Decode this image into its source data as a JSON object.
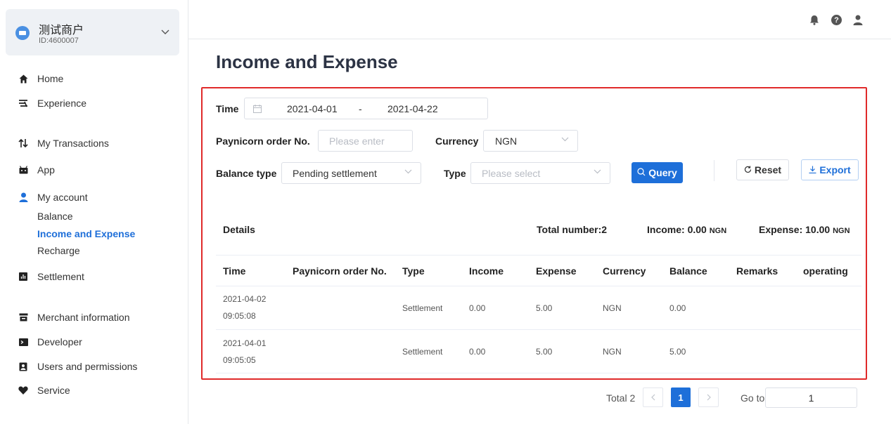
{
  "merchant": {
    "name": "测试商户",
    "id": "ID:4600007"
  },
  "sidebar": {
    "items": [
      {
        "key": "home",
        "label": "Home",
        "icon": "home-icon"
      },
      {
        "key": "experience",
        "label": "Experience",
        "icon": "experience-icon"
      },
      {
        "key": "transactions",
        "label": "My Transactions",
        "icon": "transactions-icon"
      },
      {
        "key": "app",
        "label": "App",
        "icon": "app-icon"
      },
      {
        "key": "account",
        "label": "My account",
        "icon": "user-icon"
      },
      {
        "key": "settlement",
        "label": "Settlement",
        "icon": "chart-icon"
      },
      {
        "key": "merchant-info",
        "label": "Merchant information",
        "icon": "store-icon"
      },
      {
        "key": "developer",
        "label": "Developer",
        "icon": "terminal-icon"
      },
      {
        "key": "users",
        "label": "Users and permissions",
        "icon": "contacts-icon"
      },
      {
        "key": "service",
        "label": "Service",
        "icon": "heart-icon"
      }
    ],
    "account_sub": [
      "Balance",
      "Income and Expense",
      "Recharge"
    ]
  },
  "page_title": "Income and Expense",
  "filters": {
    "time_label": "Time",
    "date_start": "2021-04-01",
    "date_sep": "-",
    "date_end": "2021-04-22",
    "order_label": "Paynicorn order No.",
    "order_placeholder": "Please enter",
    "currency_label": "Currency",
    "currency_value": "NGN",
    "balance_type_label": "Balance type",
    "balance_type_value": "Pending settlement",
    "type_label": "Type",
    "type_placeholder": "Please select",
    "query_label": "Query",
    "reset_label": "Reset",
    "export_label": "Export"
  },
  "summary": {
    "details": "Details",
    "total": "Total number:2",
    "income_label": "Income: 0.00",
    "income_unit": "NGN",
    "expense_label": "Expense: 10.00",
    "expense_unit": "NGN"
  },
  "table": {
    "headers": [
      "Time",
      "Paynicorn order No.",
      "Type",
      "Income",
      "Expense",
      "Currency",
      "Balance",
      "Remarks",
      "operating"
    ],
    "rows": [
      {
        "date": "2021-04-02",
        "time": "09:05:08",
        "order": "",
        "type": "Settlement",
        "income": "0.00",
        "expense": "5.00",
        "currency": "NGN",
        "balance": "0.00",
        "remarks": "",
        "operating": ""
      },
      {
        "date": "2021-04-01",
        "time": "09:05:05",
        "order": "",
        "type": "Settlement",
        "income": "0.00",
        "expense": "5.00",
        "currency": "NGN",
        "balance": "5.00",
        "remarks": "",
        "operating": ""
      }
    ]
  },
  "pagination": {
    "total": "Total 2",
    "current": "1",
    "goto_label": "Go to",
    "goto_value": "1"
  },
  "colors": {
    "accent": "#1e6fd9",
    "highlight_border": "#e02a2a"
  }
}
